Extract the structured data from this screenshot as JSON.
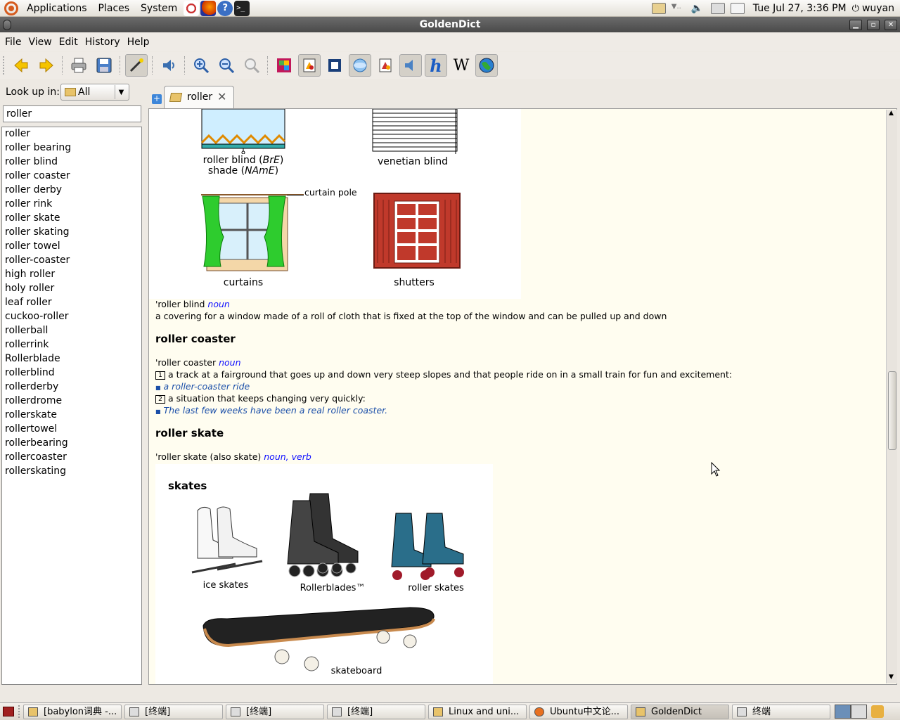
{
  "top_panel": {
    "menus": [
      "Applications",
      "Places",
      "System"
    ],
    "datetime": "Tue Jul 27,  3:36 PM",
    "user": "wuyan"
  },
  "window": {
    "title": "GoldenDict"
  },
  "menubar": [
    {
      "label": "File"
    },
    {
      "label": "View"
    },
    {
      "label": "Edit"
    },
    {
      "label": "History"
    },
    {
      "label": "Help"
    }
  ],
  "sidebar": {
    "lookup_label": "Look up in:",
    "dict_selected": "All",
    "search_value": "roller",
    "words": [
      "roller",
      "roller bearing",
      "roller blind",
      "roller coaster",
      "roller derby",
      "roller rink",
      "roller skate",
      "roller skating",
      "roller towel",
      "roller-coaster",
      "high roller",
      "holy roller",
      "leaf roller",
      "cuckoo-roller",
      "rollerball",
      "rollerrink",
      "Rollerblade",
      "rollerblind",
      "rollerderby",
      "rollerdrome",
      "rollerskate",
      "rollertowel",
      "rollerbearing",
      "rollercoaster",
      "rollerskating"
    ]
  },
  "tabs": [
    {
      "label": "roller"
    }
  ],
  "article": {
    "blinds_captions": {
      "roller_blind": "roller blind (",
      "bre": "BrE",
      "roller_blind_end": ")",
      "shade": "shade (",
      "ame": "NAmE",
      "shade_end": ")",
      "venetian": "venetian blind",
      "curtain_pole": "curtain pole",
      "curtains": "curtains",
      "shutters": "shutters"
    },
    "roller_blind": {
      "word": "'roller blind",
      "pos": "noun",
      "definition": "a covering for a window made of a roll of cloth that is fixed at the top of the window and can be pulled up and down"
    },
    "roller_coaster": {
      "heading": "roller coaster",
      "word": "'roller coaster",
      "pos": "noun",
      "sense1_num": "1",
      "sense1": "a track at a fairground that goes up and down very steep slopes and that people ride on in a small train for fun and excitement:",
      "example1": "a roller-coaster ride",
      "sense2_num": "2",
      "sense2": "a situation that keeps changing very quickly:",
      "example2": "The last few weeks have been a real roller coaster."
    },
    "roller_skate": {
      "heading": "roller skate",
      "word": "'roller skate (also skate)",
      "pos1": "noun",
      "comma": ",",
      "pos2": "verb"
    },
    "skates_pic": {
      "title": "skates",
      "ice": "ice skates",
      "rollerblades": "Rollerblades™",
      "roller": "roller skates",
      "skateboard": "skateboard"
    }
  },
  "taskbar": [
    {
      "label": "[babylon词典 -..."
    },
    {
      "label": "[终端]"
    },
    {
      "label": "[终端]"
    },
    {
      "label": "[终端]"
    },
    {
      "label": "Linux and uni..."
    },
    {
      "label": "Ubuntu中文论..."
    },
    {
      "label": "GoldenDict"
    },
    {
      "label": "终端"
    }
  ]
}
